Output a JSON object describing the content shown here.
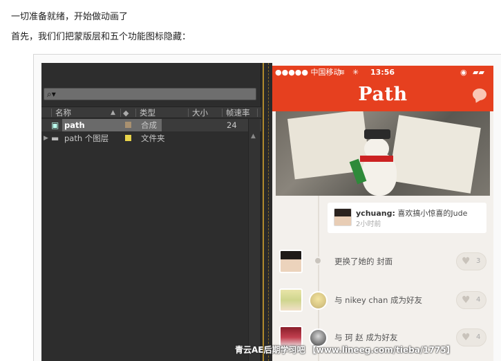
{
  "article": {
    "para1": "一切准备就绪，开始做动画了",
    "para2": "首先，我们们把蒙版层和五个功能图标隐藏："
  },
  "ae_project": {
    "search_icon": "magnifier-icon",
    "columns": {
      "name": "名称",
      "type": "类型",
      "size": "大小",
      "framerate": "帧速率"
    },
    "rows": [
      {
        "name": "path",
        "type": "合成",
        "framerate": "24",
        "swatch": "#a89070",
        "icon": "composition-icon"
      },
      {
        "name": "path 个图层",
        "type": "文件夹",
        "framerate": "",
        "swatch": "#e8d44a",
        "icon": "folder-icon"
      }
    ]
  },
  "phone": {
    "status": {
      "signal": "●●●●● 中国移动",
      "time": "13:56"
    },
    "app_title": "Path",
    "colors": {
      "brand": "#e6401f",
      "background": "#f3f0ec"
    },
    "moment": {
      "user": "ychuang:",
      "text": " 喜欢搞小惊喜的Jude",
      "time": "2小时前"
    },
    "feed": [
      {
        "text": "更换了她的 封面",
        "likes": "3"
      },
      {
        "text": "与 nikey chan 成为好友",
        "likes": "4"
      },
      {
        "text": "与 珂 赵 成为好友",
        "likes": "4"
      }
    ]
  },
  "watermark": "青云AE后期学习吧 【www.lineeg.com/tieba/1775】"
}
